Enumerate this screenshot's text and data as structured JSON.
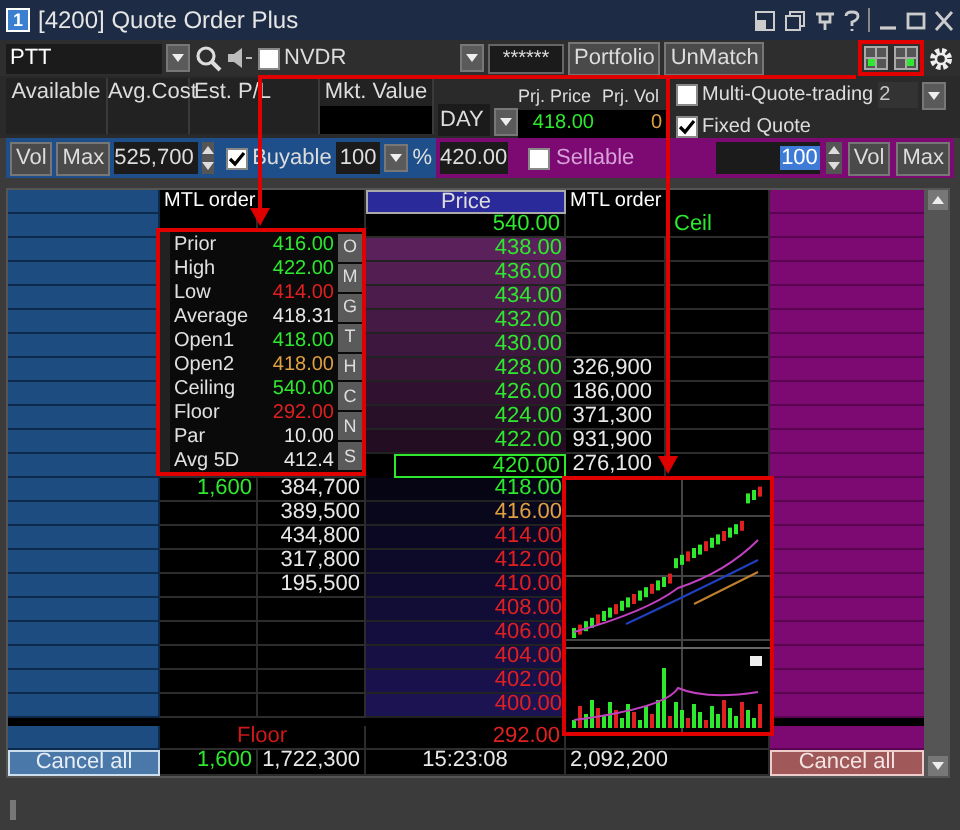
{
  "window": {
    "title": "[4200] Quote Order Plus",
    "badge": "1"
  },
  "toolbar": {
    "symbol": "PTT",
    "nvdr": {
      "label": "NVDR",
      "checked": false
    },
    "pin": "******",
    "buttons": [
      "Portfolio",
      "UnMatch"
    ]
  },
  "account": {
    "columns": [
      "Available",
      "Avg.Cost",
      "Est. P/L",
      "Mkt. Value"
    ],
    "validity": "DAY",
    "prj_price_label": "Prj. Price",
    "prj_price": "418.00",
    "prj_vol_label": "Prj. Vol",
    "prj_vol": "0",
    "multi_quote": {
      "label": "Multi-Quote-trading",
      "checked": false,
      "value": "2"
    },
    "fixed_quote": {
      "label": "Fixed Quote",
      "checked": true
    }
  },
  "order_bar": {
    "buy": {
      "vol": "Vol",
      "max": "Max",
      "volume": "525,700",
      "buyable": {
        "label": "Buyable",
        "checked": true
      },
      "percent": "100",
      "percent_sign": "%"
    },
    "price": "420.00",
    "sell": {
      "sellable": {
        "label": "Sellable",
        "checked": false
      },
      "percent": "100",
      "vol": "Vol",
      "max": "Max"
    }
  },
  "ladder": {
    "headers": [
      "MTL order",
      "Price",
      "MTL order"
    ],
    "ceiling": {
      "price": "540.00",
      "label": "Ceil"
    },
    "rows": [
      {
        "price": "438.00",
        "kind": "ask",
        "selected": false
      },
      {
        "price": "436.00",
        "kind": "ask",
        "selected": false
      },
      {
        "price": "434.00",
        "kind": "ask",
        "selected": false
      },
      {
        "price": "432.00",
        "kind": "ask",
        "selected": false
      },
      {
        "price": "430.00",
        "kind": "ask",
        "selected": false
      },
      {
        "price": "428.00",
        "kind": "ask",
        "ask_vol": "326,900",
        "selected": false
      },
      {
        "price": "426.00",
        "kind": "ask",
        "ask_vol": "186,000",
        "selected": false
      },
      {
        "price": "424.00",
        "kind": "ask",
        "ask_vol": "371,300",
        "selected": false
      },
      {
        "price": "422.00",
        "kind": "ask",
        "ask_vol": "931,900",
        "selected": false
      },
      {
        "price": "420.00",
        "kind": "ask",
        "ask_vol": "276,100",
        "selected": true
      },
      {
        "price": "418.00",
        "kind": "bid",
        "bid_count": "1,600",
        "bid_vol": "384,700",
        "selected": false
      },
      {
        "price": "416.00",
        "kind": "bid",
        "bid_vol": "389,500",
        "selected": false
      },
      {
        "price": "414.00",
        "kind": "bid",
        "bid_vol": "434,800",
        "selected": false
      },
      {
        "price": "412.00",
        "kind": "bid",
        "bid_vol": "317,800",
        "selected": false
      },
      {
        "price": "410.00",
        "kind": "bid",
        "bid_vol": "195,500",
        "selected": false
      },
      {
        "price": "408.00",
        "kind": "bid",
        "selected": false
      },
      {
        "price": "406.00",
        "kind": "bid",
        "selected": false
      },
      {
        "price": "404.00",
        "kind": "bid",
        "selected": false
      },
      {
        "price": "402.00",
        "kind": "bid",
        "selected": false
      },
      {
        "price": "400.00",
        "kind": "bid",
        "selected": false
      }
    ],
    "floor": {
      "label": "Floor",
      "price": "292.00"
    },
    "totals": {
      "bid_count": "1,600",
      "bid_vol": "1,722,300",
      "time": "15:23:08",
      "ask_vol": "2,092,200"
    },
    "cancel_buttons": [
      "Cancel all",
      "Cancel all"
    ]
  },
  "info_panel": {
    "items": [
      {
        "label": "Prior",
        "value": "416.00",
        "color": "#2ee82e"
      },
      {
        "label": "High",
        "value": "422.00",
        "color": "#2ee82e"
      },
      {
        "label": "Low",
        "value": "414.00",
        "color": "#e02020"
      },
      {
        "label": "Average",
        "value": "418.31",
        "color": "#e8e8e8"
      },
      {
        "label": "Open1",
        "value": "418.00",
        "color": "#2ee82e"
      },
      {
        "label": "Open2",
        "value": "418.00",
        "color": "#e0a040"
      },
      {
        "label": "Ceiling",
        "value": "540.00",
        "color": "#2ee82e"
      },
      {
        "label": "Floor",
        "value": "292.00",
        "color": "#e02020"
      },
      {
        "label": "Par",
        "value": "10.00",
        "color": "#e8e8e8"
      },
      {
        "label": "Avg 5D",
        "value": "412.4",
        "color": "#e8e8e8"
      }
    ],
    "tabs": [
      "O",
      "M",
      "G",
      "T",
      "H",
      "C",
      "N",
      "S"
    ]
  }
}
